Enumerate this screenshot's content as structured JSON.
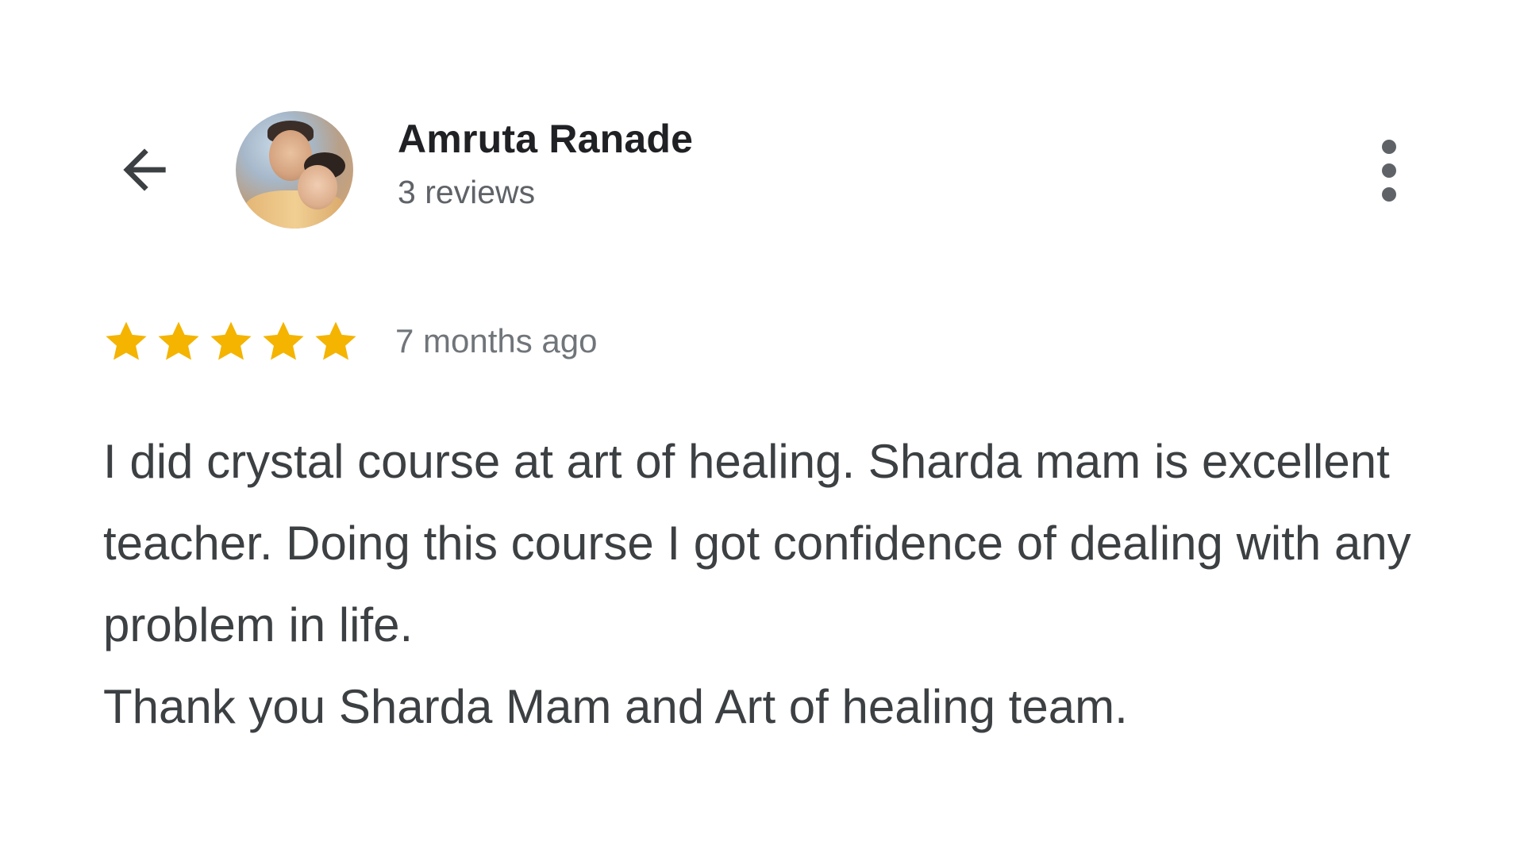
{
  "reviewer": {
    "name": "Amruta Ranade",
    "review_count": "3 reviews"
  },
  "review": {
    "rating": 5,
    "rating_max": 5,
    "time": "7 months ago",
    "text_paragraph_1": "I did crystal course at art of healing. Sharda mam is excellent teacher. Doing this course I got confidence of dealing with any problem in life.",
    "text_paragraph_2": "Thank you Sharda Mam and Art of healing team."
  },
  "icons": {
    "back": "arrow-back-icon",
    "menu": "more-vert-icon",
    "star": "star-icon"
  },
  "colors": {
    "star": "#F4B400",
    "name": "#202124",
    "secondary": "#5f6368",
    "body": "#3c4043"
  }
}
